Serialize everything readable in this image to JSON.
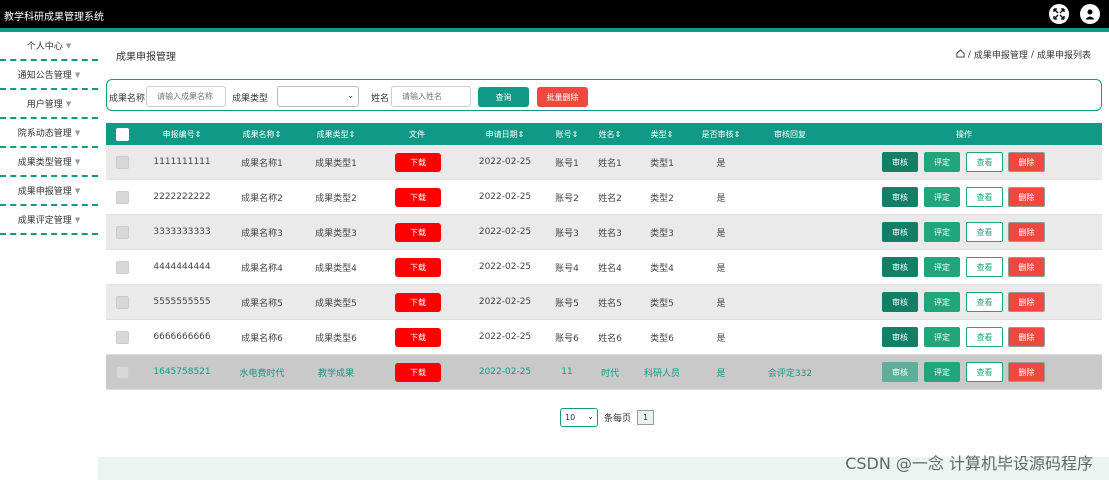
{
  "app": {
    "title": "教学科研成果管理系统"
  },
  "sidebar": {
    "items": [
      {
        "label": "个人中心"
      },
      {
        "label": "通知公告管理"
      },
      {
        "label": "用户管理"
      },
      {
        "label": "院系动态管理"
      },
      {
        "label": "成果类型管理"
      },
      {
        "label": "成果申报管理"
      },
      {
        "label": "成果评定管理"
      }
    ]
  },
  "page": {
    "title": "成果申报管理",
    "breadcrumb": [
      "成果申报管理",
      "成果申报列表"
    ]
  },
  "search": {
    "name_label": "成果名称",
    "name_placeholder": "请输入成果名称",
    "type_label": "成果类型",
    "person_label": "姓名",
    "person_placeholder": "请输入姓名",
    "query_btn": "查询",
    "batch_delete_btn": "批量删除"
  },
  "table": {
    "headers": [
      "申报编号",
      "成果名称",
      "成果类型",
      "文件",
      "申请日期",
      "账号",
      "姓名",
      "类型",
      "是否审核",
      "审核回复",
      "操作"
    ],
    "download_label": "下载",
    "ops": {
      "audit": "审核",
      "rate": "评定",
      "view": "查看",
      "delete": "删除"
    },
    "rows": [
      {
        "id": "1111111111",
        "name": "成果名称1",
        "type": "成果类型1",
        "date": "2022-02-25",
        "account": "账号1",
        "person": "姓名1",
        "kind": "类型1",
        "audited": "是",
        "reply": ""
      },
      {
        "id": "2222222222",
        "name": "成果名称2",
        "type": "成果类型2",
        "date": "2022-02-25",
        "account": "账号2",
        "person": "姓名2",
        "kind": "类型2",
        "audited": "是",
        "reply": ""
      },
      {
        "id": "3333333333",
        "name": "成果名称3",
        "type": "成果类型3",
        "date": "2022-02-25",
        "account": "账号3",
        "person": "姓名3",
        "kind": "类型3",
        "audited": "是",
        "reply": ""
      },
      {
        "id": "4444444444",
        "name": "成果名称4",
        "type": "成果类型4",
        "date": "2022-02-25",
        "account": "账号4",
        "person": "姓名4",
        "kind": "类型4",
        "audited": "是",
        "reply": ""
      },
      {
        "id": "5555555555",
        "name": "成果名称5",
        "type": "成果类型5",
        "date": "2022-02-25",
        "account": "账号5",
        "person": "姓名5",
        "kind": "类型5",
        "audited": "是",
        "reply": ""
      },
      {
        "id": "6666666666",
        "name": "成果名称6",
        "type": "成果类型6",
        "date": "2022-02-25",
        "account": "账号6",
        "person": "姓名6",
        "kind": "类型6",
        "audited": "是",
        "reply": ""
      },
      {
        "id": "1645758521",
        "name": "水电费时代",
        "type": "教学成果",
        "date": "2022-02-25",
        "account": "11",
        "person": "时代",
        "kind": "科研人员",
        "audited": "是",
        "reply": "会评定332"
      }
    ]
  },
  "pager": {
    "page_size": "10",
    "total_label": "条每页",
    "current_page": "1"
  },
  "watermark": "CSDN @一念 计算机毕设源码程序",
  "colors": {
    "accent": "#109a86",
    "danger": "#ff0000",
    "topbar": "#000000"
  }
}
